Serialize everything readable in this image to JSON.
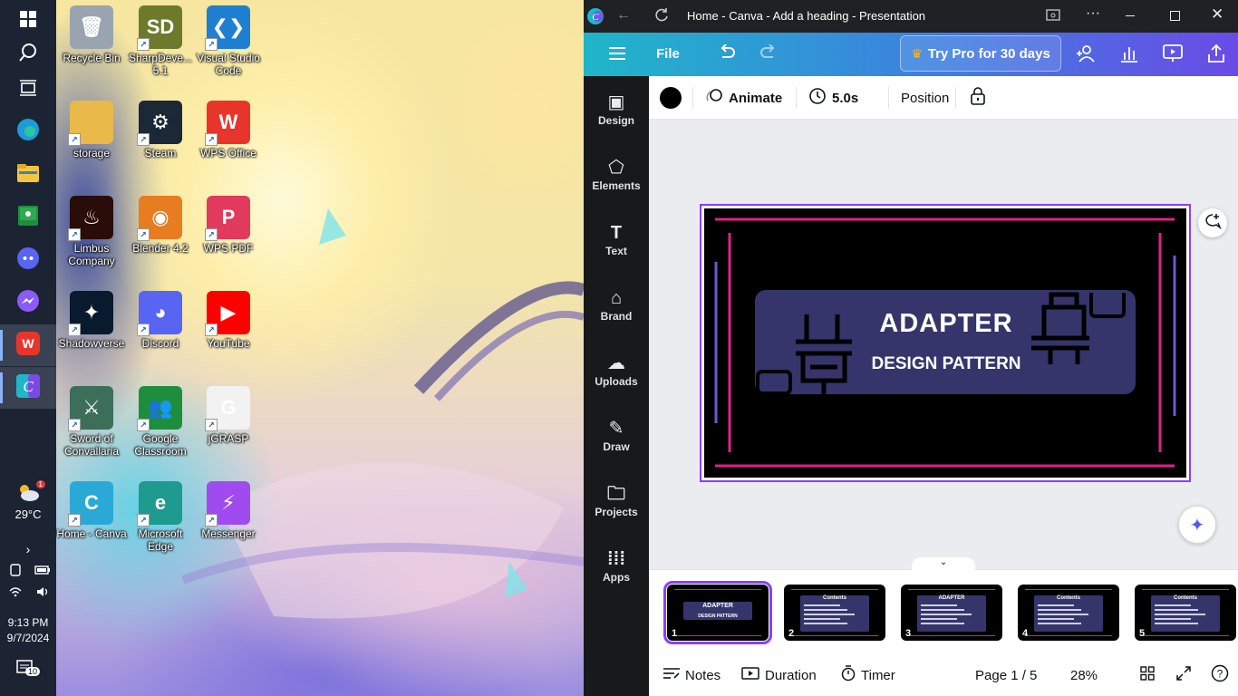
{
  "taskbar": {
    "apps": [
      {
        "name": "start",
        "icon": "windows-icon"
      },
      {
        "name": "search",
        "icon": "search-icon"
      },
      {
        "name": "task-view",
        "icon": "task-view-icon"
      },
      {
        "name": "edge",
        "icon": "edge-icon"
      },
      {
        "name": "file-explorer",
        "icon": "folder-icon"
      },
      {
        "name": "classroom",
        "icon": "classroom-icon"
      },
      {
        "name": "discord",
        "icon": "discord-icon"
      },
      {
        "name": "messenger",
        "icon": "messenger-icon"
      },
      {
        "name": "wps",
        "icon": "wps-icon"
      },
      {
        "name": "canva",
        "icon": "canva-icon"
      }
    ],
    "weather": {
      "temp": "29°C",
      "badge": "1"
    },
    "time": "9:13 PM",
    "date": "9/7/2024",
    "notification_count": "10"
  },
  "desktop": {
    "icons": [
      {
        "label": "Recycle Bin",
        "color": "#9aa4b1",
        "glyph": "🗑"
      },
      {
        "label": "SharpDeve...\n5.1",
        "color": "#6d7a2b",
        "glyph": "SD"
      },
      {
        "label": "Visual Studio Code",
        "color": "#1f7fd1",
        "glyph": "❮❯"
      },
      {
        "label": "storage",
        "color": "#e9b949",
        "glyph": ""
      },
      {
        "label": "Steam",
        "color": "#1b2838",
        "glyph": "⚙"
      },
      {
        "label": "WPS Office",
        "color": "#e8352b",
        "glyph": "W"
      },
      {
        "label": "Limbus Company",
        "color": "#2a0c08",
        "glyph": "♨"
      },
      {
        "label": "Blender 4.2",
        "color": "#e77c20",
        "glyph": "◉"
      },
      {
        "label": "WPS PDF",
        "color": "#e13a5c",
        "glyph": "P"
      },
      {
        "label": "Shadowverse",
        "color": "#0a1a2e",
        "glyph": "✦"
      },
      {
        "label": "Discord",
        "color": "#5865f2",
        "glyph": "◕"
      },
      {
        "label": "YouTube",
        "color": "#ff0000",
        "glyph": "▶"
      },
      {
        "label": "Sword of Convallaria",
        "color": "#3c6e5a",
        "glyph": "⚔"
      },
      {
        "label": "Google Classroom",
        "color": "#1e8e3e",
        "glyph": "👥"
      },
      {
        "label": "jGRASP",
        "color": "#f2f2f2",
        "glyph": "G"
      },
      {
        "label": "Home - Canva",
        "color": "#2aa9d6",
        "glyph": "C"
      },
      {
        "label": "Microsoft Edge",
        "color": "#1f9a8f",
        "glyph": "e"
      },
      {
        "label": "Messenger",
        "color": "#a04bf0",
        "glyph": "⚡"
      }
    ]
  },
  "window": {
    "title": "Home - Canva - Add a heading - Presentation"
  },
  "topbar": {
    "menu_icon": "menu-icon",
    "file_label": "File",
    "try_pro_label": "Try Pro for 30 days"
  },
  "sidebar": {
    "items": [
      {
        "label": "Design",
        "glyph": "▣"
      },
      {
        "label": "Elements",
        "glyph": "⬠"
      },
      {
        "label": "Text",
        "glyph": "T"
      },
      {
        "label": "Brand",
        "glyph": "⌂"
      },
      {
        "label": "Uploads",
        "glyph": "☁"
      },
      {
        "label": "Draw",
        "glyph": "✎"
      },
      {
        "label": "Projects",
        "glyph": "🗀"
      },
      {
        "label": "Apps",
        "glyph": "⁞⁞⁞"
      }
    ]
  },
  "toolbar": {
    "color": "#000000",
    "animate_label": "Animate",
    "duration_label": "5.0s",
    "position_label": "Position"
  },
  "slide": {
    "title": "ADAPTER",
    "subtitle": "DESIGN PATTERN",
    "accent": "#e0218a",
    "panel": "#35356b"
  },
  "pages": {
    "thumbnails": [
      {
        "num": "1",
        "title": "ADAPTER",
        "sub": "DESIGN PATTERN"
      },
      {
        "num": "2",
        "title": "Contents",
        "sub": ""
      },
      {
        "num": "3",
        "title": "ADAPTER",
        "sub": ""
      },
      {
        "num": "4",
        "title": "Contents",
        "sub": ""
      },
      {
        "num": "5",
        "title": "Contents",
        "sub": ""
      }
    ]
  },
  "footer": {
    "notes_label": "Notes",
    "duration_label": "Duration",
    "timer_label": "Timer",
    "page_label": "Page 1 / 5",
    "zoom_label": "28%"
  }
}
